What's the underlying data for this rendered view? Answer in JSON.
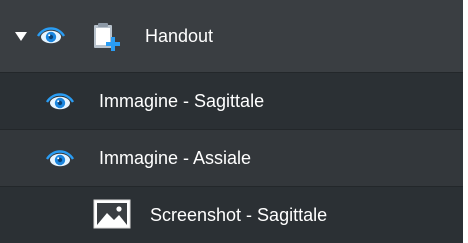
{
  "colors": {
    "row_header": "#3a3e42",
    "row_dark": "#2b3034",
    "row_alt": "#33373b",
    "eye_blue": "#2a9df4",
    "text": "#ffffff"
  },
  "tree": {
    "root": {
      "label": "Handout",
      "expanded": true,
      "icons": [
        "expand-triangle-icon",
        "eye-icon",
        "document-add-icon"
      ]
    },
    "items": [
      {
        "label": "Immagine - Sagittale",
        "icon": "eye-icon"
      },
      {
        "label": "Immagine - Assiale",
        "icon": "eye-icon"
      },
      {
        "label": "Screenshot - Sagittale",
        "icon": "image-icon"
      }
    ]
  }
}
